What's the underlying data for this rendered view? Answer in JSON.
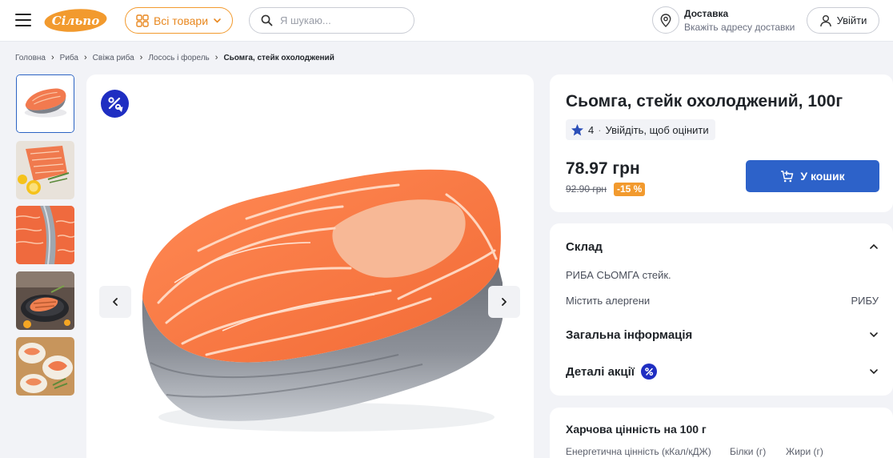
{
  "header": {
    "logo_text": "Сільпо",
    "catalog_label": "Всі товари",
    "search_placeholder": "Я шукаю...",
    "delivery_title": "Доставка",
    "delivery_subtitle": "Вкажіть адресу доставки",
    "login_label": "Увійти"
  },
  "breadcrumb": {
    "items": [
      "Головна",
      "Риба",
      "Свіжа риба",
      "Лосось і форель"
    ],
    "current": "Сьомга, стейк охолоджений"
  },
  "gallery": {
    "thumbnail_count": 5,
    "active_index": 0
  },
  "product": {
    "title": "Сьомга, стейк охолоджений, 100г",
    "rating": "4",
    "rating_dot": "·",
    "rate_prompt": "Увійдіть, щоб оцінити",
    "price": "78.97 грн",
    "old_price": "92.90 грн",
    "discount": "-15 %",
    "cart_label": "У кошик"
  },
  "composition": {
    "heading": "Склад",
    "text": "РИБА СЬОМГА стейк.",
    "allergen_label": "Містить алергени",
    "allergen_value": "РИБУ",
    "general_info": "Загальна інформація",
    "promo_details": "Деталі акції"
  },
  "nutrition": {
    "heading": "Харчова цінність на 100 г",
    "columns": [
      "Енергетична цінність (кКал/кДЖ)",
      "Білки (г)",
      "Жири (г)"
    ]
  },
  "colors": {
    "accent_orange": "#f29a2e",
    "brand_blue": "#2d62c9",
    "promo_blue": "#1f2ec2"
  }
}
